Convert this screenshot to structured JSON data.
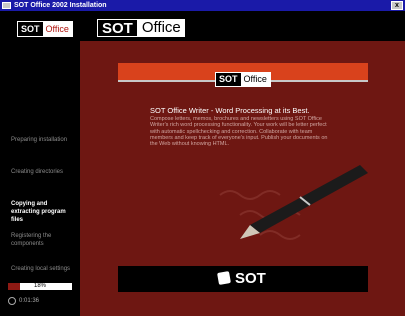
{
  "window": {
    "title": "SOT Office 2002 Installation",
    "close_label": "x"
  },
  "sidebar": {
    "logo": {
      "brand": "SOT",
      "product": "Office"
    },
    "steps": [
      {
        "label": "Preparing installation",
        "active": false
      },
      {
        "label": "Creating directories",
        "active": false
      },
      {
        "label": "Copying and extracting program files",
        "active": true
      },
      {
        "label": "Registering the components",
        "active": false
      },
      {
        "label": "Creating local settings",
        "active": false
      }
    ],
    "progress": {
      "percent": 18,
      "label": "18%"
    },
    "elapsed_time": "0:01:36"
  },
  "header": {
    "logo": {
      "brand": "SOT",
      "product": "Office"
    }
  },
  "content": {
    "banner_logo": {
      "brand": "SOT",
      "product": "Office"
    },
    "headline": "SOT Office Writer - Word Processing at its Best.",
    "description": "Compose letters, memos, brochures and newsletters using SOT Office Writer's rich word processing functionality. Your work will be letter perfect with automatic spellchecking and correction. Collaborate with team members and keep track of everyone's input. Publish your documents on the Web without knowing HTML.",
    "bottom_brand": "SOT"
  },
  "colors": {
    "background": "#6e1712",
    "sidebar": "#000000",
    "accent_orange": "#d9421c",
    "titlebar": "#1a1aa8",
    "active_step": "#ffffff",
    "inactive_step": "#8a8a8a"
  }
}
